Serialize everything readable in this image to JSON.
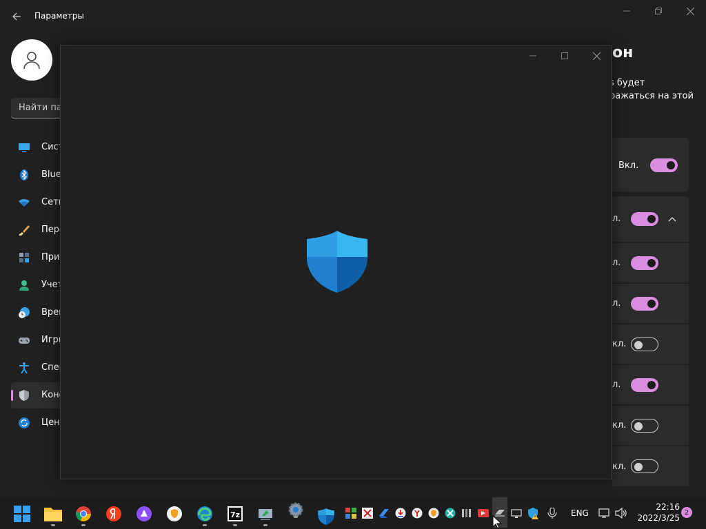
{
  "settings": {
    "title": "Параметры",
    "search_placeholder": "Найти пар",
    "page_title_fragment": "он",
    "description_line1": "s будет",
    "description_line2": "ражаться на этой",
    "nav": [
      {
        "label": "Сист",
        "icon": "display-icon"
      },
      {
        "label": "Blue",
        "icon": "bluetooth-icon"
      },
      {
        "label": "Сеть",
        "icon": "wifi-icon"
      },
      {
        "label": "Перс",
        "icon": "brush-icon"
      },
      {
        "label": "Прил",
        "icon": "apps-icon"
      },
      {
        "label": "Учет",
        "icon": "account-icon"
      },
      {
        "label": "Врем",
        "icon": "clock-globe-icon"
      },
      {
        "label": "Игры",
        "icon": "gamepad-icon"
      },
      {
        "label": "Спец",
        "icon": "accessibility-icon"
      },
      {
        "label": "Конф",
        "icon": "shield-icon"
      },
      {
        "label": "Цент",
        "icon": "update-icon"
      }
    ],
    "toggles": [
      {
        "label": "Вкл.",
        "state": "on"
      },
      {
        "label": "л.",
        "state": "on"
      },
      {
        "label": "л.",
        "state": "on"
      },
      {
        "label": "л.",
        "state": "on"
      },
      {
        "label": "кл.",
        "state": "off"
      },
      {
        "label": "л.",
        "state": "on"
      },
      {
        "label": "кл.",
        "state": "off"
      },
      {
        "label": "кл.",
        "state": "off"
      }
    ]
  },
  "taskbar": {
    "lang": "ENG",
    "time": "22:16",
    "date": "2022/3/25",
    "notification_count": "2"
  },
  "colors": {
    "accent": "#d88ddd",
    "shield_light": "#38b6f0",
    "shield_dark": "#0f5fa8"
  }
}
